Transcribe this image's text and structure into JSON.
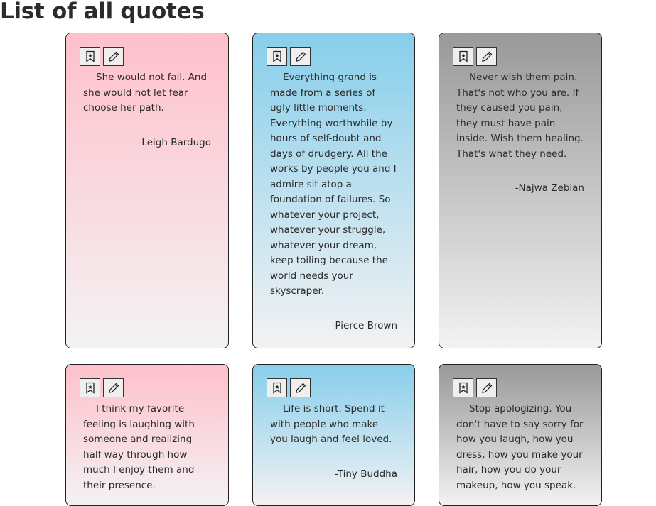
{
  "page": {
    "title": "List of all quotes"
  },
  "quotes": [
    {
      "text": "She would not fail. And she would not let fear choose her path.",
      "author": "-Leigh Bardugo",
      "theme": "pink"
    },
    {
      "text": "Everything grand is made from a series of ugly little moments. Everything worthwhile by hours of self-doubt and days of drudgery. All the works by people you and I admire sit atop a foundation of failures. So whatever your project, whatever your struggle, whatever your dream, keep toiling because the world needs your skyscraper.",
      "author": "-Pierce Brown",
      "theme": "blue"
    },
    {
      "text": "Never wish them pain. That's not who you are. If they caused you pain, they must have pain inside. Wish them healing. That's what they need.",
      "author": "-Najwa Zebian",
      "theme": "gray"
    },
    {
      "text": "I think my favorite feeling is laughing with someone and realizing half way through how much I enjoy them and their presence.",
      "author": "",
      "theme": "pink"
    },
    {
      "text": "Life is short. Spend it with people who make you laugh and feel loved.",
      "author": "-Tiny Buddha",
      "theme": "blue"
    },
    {
      "text": "Stop apologizing. You don't have to say sorry for how you laugh, how you dress, how you make your hair, how you do your makeup, how you speak.",
      "author": "",
      "theme": "gray"
    }
  ],
  "icons": {
    "bookmark": "bookmark-icon",
    "edit": "pencil-icon"
  },
  "colors": {
    "pink": "#ffc0cb",
    "blue": "#87ceeb",
    "gray": "#999999",
    "fade": "#f3f2f3"
  }
}
